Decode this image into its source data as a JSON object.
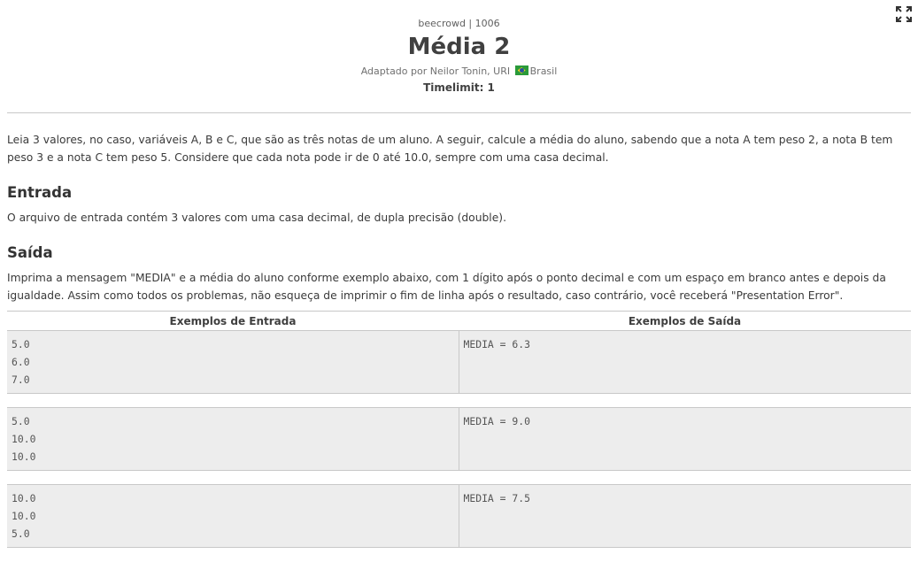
{
  "header": {
    "crumb": "beecrowd | 1006",
    "title": "Média 2",
    "author_prefix": "Adaptado por Neilor Tonin, URI",
    "country": "Brasil",
    "timelimit": "Timelimit: 1"
  },
  "description": "Leia 3 valores, no caso, variáveis A, B e C, que são as três notas de um aluno. A seguir, calcule a média do aluno, sabendo que a nota A tem peso 2, a nota B tem peso 3 e a nota C tem peso 5. Considere que cada nota pode ir de 0 até 10.0, sempre com uma casa decimal.",
  "entrada": {
    "heading": "Entrada",
    "text": "O arquivo de entrada contém 3 valores com uma casa decimal, de dupla precisão (double)."
  },
  "saida": {
    "heading": "Saída",
    "text": "Imprima a mensagem \"MEDIA\" e a média do aluno conforme exemplo abaixo, com 1 dígito após o ponto decimal e com um espaço em branco antes e depois da igualdade. Assim como todos os problemas, não esqueça de imprimir o fim de linha após o resultado, caso contrário, você receberá \"Presentation Error\"."
  },
  "examples": {
    "input_header": "Exemplos de Entrada",
    "output_header": "Exemplos de Saída",
    "rows": [
      {
        "input": [
          "5.0",
          "6.0",
          "7.0"
        ],
        "output": [
          "MEDIA = 6.3"
        ]
      },
      {
        "input": [
          "5.0",
          "10.0",
          "10.0"
        ],
        "output": [
          "MEDIA = 9.0"
        ]
      },
      {
        "input": [
          "10.0",
          "10.0",
          "5.0"
        ],
        "output": [
          "MEDIA = 7.5"
        ]
      }
    ]
  },
  "icons": {
    "expand": "expand-icon",
    "flag": "brazil-flag-icon"
  }
}
